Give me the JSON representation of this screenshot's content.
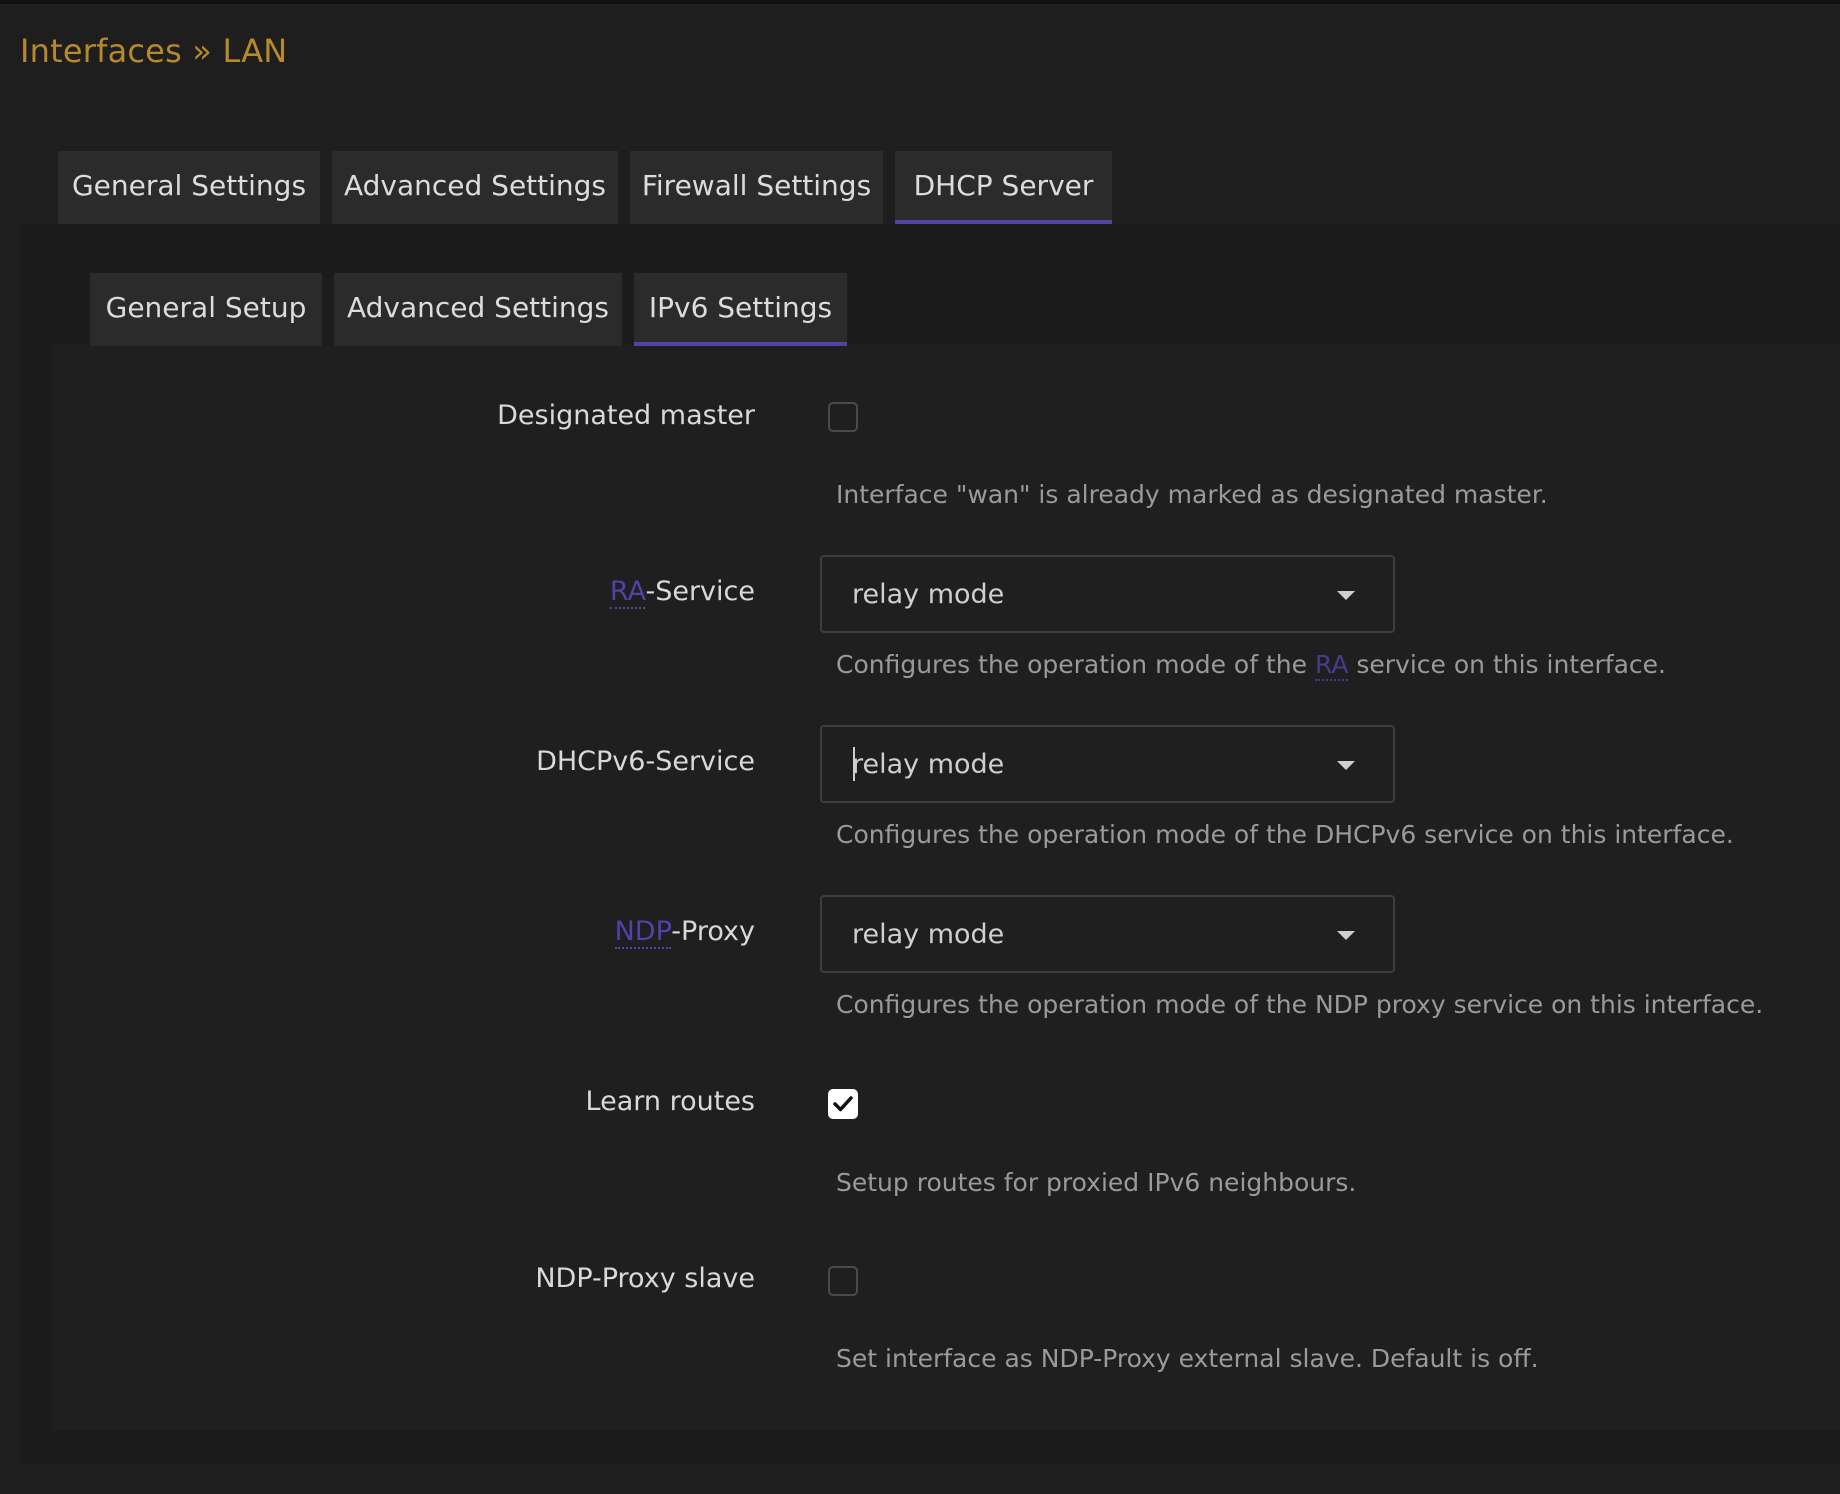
{
  "page": {
    "title": "Interfaces » LAN"
  },
  "main_tabs": [
    {
      "label": "General Settings",
      "active": false
    },
    {
      "label": "Advanced Settings",
      "active": false
    },
    {
      "label": "Firewall Settings",
      "active": false
    },
    {
      "label": "DHCP Server",
      "active": true
    }
  ],
  "sub_tabs": [
    {
      "label": "General Setup",
      "active": false
    },
    {
      "label": "Advanced Settings",
      "active": false
    },
    {
      "label": "IPv6 Settings",
      "active": true
    }
  ],
  "fields": {
    "designated_master": {
      "label": "Designated master",
      "checked": false,
      "description": "Interface \"wan\" is already marked as designated master."
    },
    "ra_service": {
      "label_abbr": "RA",
      "label_rest": "-Service",
      "value": "relay mode",
      "desc_before": "Configures the operation mode of the ",
      "desc_abbr": "RA",
      "desc_after": " service on this interface."
    },
    "dhcpv6_service": {
      "label": "DHCPv6-Service",
      "value": "relay mode",
      "description": "Configures the operation mode of the DHCPv6 service on this interface."
    },
    "ndp_proxy": {
      "label_abbr": "NDP",
      "label_rest": "-Proxy",
      "value": "relay mode",
      "description": "Configures the operation mode of the NDP proxy service on this interface."
    },
    "learn_routes": {
      "label": "Learn routes",
      "checked": true,
      "description": "Setup routes for proxied IPv6 neighbours."
    },
    "ndp_proxy_slave": {
      "label": "NDP-Proxy slave",
      "checked": false,
      "description": "Set interface as NDP-Proxy external slave. Default is off."
    }
  },
  "colors": {
    "title": "#b8892a",
    "accent": "#4f43a8",
    "background": "#1e1e1e",
    "tab_background": "#2b2b2b"
  },
  "icons": {
    "dropdown": "caret-down-icon",
    "check": "checkmark-icon"
  }
}
